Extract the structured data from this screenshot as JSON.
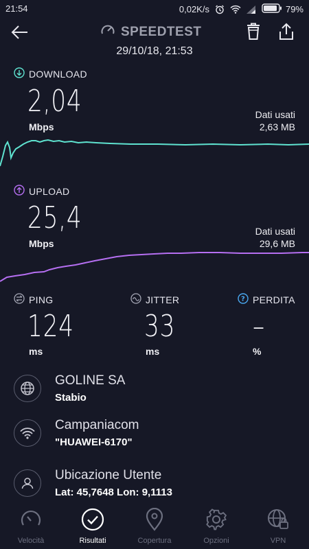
{
  "status_bar": {
    "time": "21:54",
    "net_speed": "0,02K/s",
    "battery": "79%"
  },
  "header": {
    "title": "SPEEDTEST",
    "datetime": "29/10/18, 21:53"
  },
  "download": {
    "label": "DOWNLOAD",
    "value": "2,04",
    "unit": "Mbps",
    "used_label": "Dati usati",
    "used_value": "2,63 MB",
    "color": "#5fe3d0"
  },
  "upload": {
    "label": "UPLOAD",
    "value": "25,4",
    "unit": "Mbps",
    "used_label": "Dati usati",
    "used_value": "29,6 MB",
    "color": "#b66ff2"
  },
  "metrics": {
    "ping": {
      "label": "PING",
      "value": "124",
      "unit": "ms"
    },
    "jitter": {
      "label": "JITTER",
      "value": "33",
      "unit": "ms"
    },
    "loss": {
      "label": "PERDITA",
      "value": "–",
      "unit": "%"
    }
  },
  "info": {
    "isp": {
      "title": "GOLINE SA",
      "sub": "Stabio"
    },
    "wifi": {
      "title": "Campaniacom",
      "sub": "\"HUAWEI-6170\""
    },
    "location": {
      "title": "Ubicazione Utente",
      "sub": "Lat: 45,7648 Lon: 9,1113"
    }
  },
  "nav": {
    "items": [
      {
        "label": "Velocità",
        "icon": "gauge-icon"
      },
      {
        "label": "Risultati",
        "icon": "check-circle-icon"
      },
      {
        "label": "Copertura",
        "icon": "map-pin-icon"
      },
      {
        "label": "Opzioni",
        "icon": "gear-icon"
      },
      {
        "label": "VPN",
        "icon": "globe-lock-icon"
      }
    ],
    "active_index": 1
  }
}
